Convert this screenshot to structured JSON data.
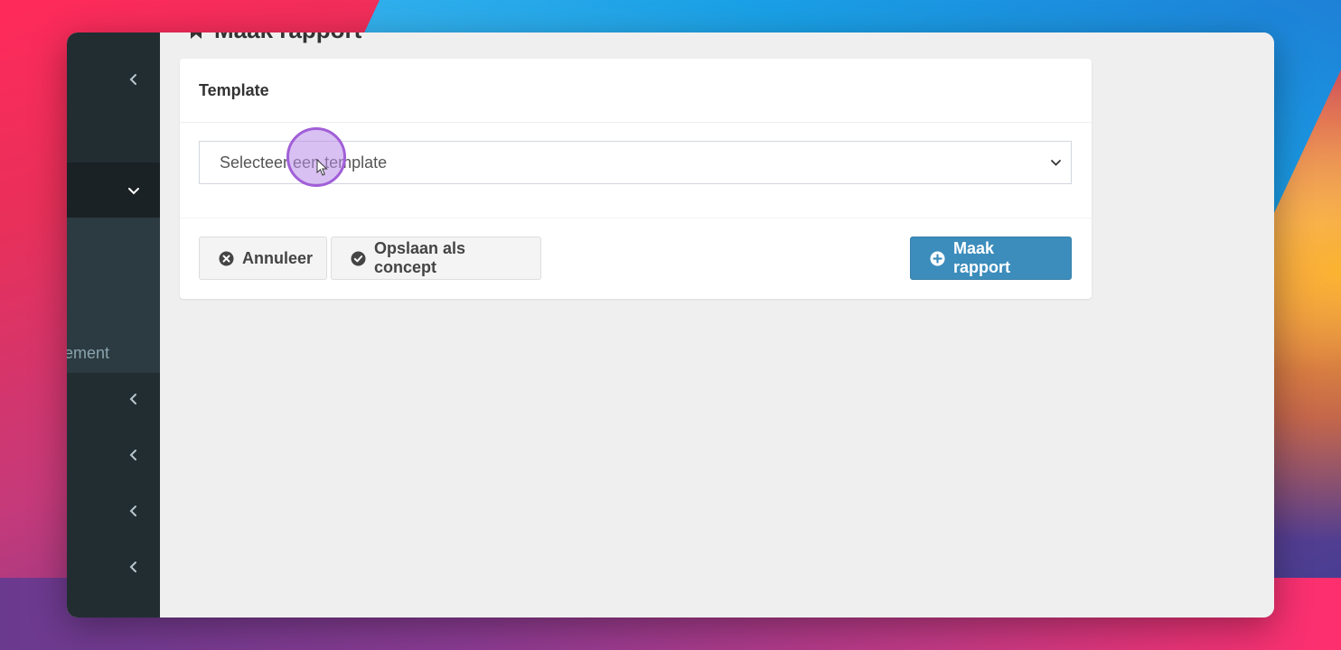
{
  "page": {
    "title": "Maak rapport",
    "title_icon": "bookmark-icon"
  },
  "sidebar": {
    "partial_label": "ement",
    "items": [
      {
        "icon": "chevron-left-icon"
      },
      {
        "icon": "chevron-down-icon",
        "active": true
      },
      {
        "icon": "chevron-left-icon"
      },
      {
        "icon": "chevron-left-icon"
      },
      {
        "icon": "chevron-left-icon"
      },
      {
        "icon": "chevron-left-icon"
      }
    ]
  },
  "form": {
    "section_title": "Template",
    "template_select": {
      "selected": "Selecteer een template",
      "icon": "chevron-down-icon"
    }
  },
  "buttons": {
    "cancel": {
      "label": "Annuleer",
      "icon": "times-circle-icon"
    },
    "save_draft": {
      "label": "Opslaan als concept",
      "icon": "check-circle-icon"
    },
    "create": {
      "label": "Maak rapport",
      "icon": "plus-circle-icon"
    }
  },
  "colors": {
    "sidebar_bg": "#222d32",
    "sidebar_sub_bg": "#2c3b41",
    "primary": "#3c8dbc",
    "content_bg": "#efefef",
    "cursor_highlight": "#a15fd8"
  }
}
